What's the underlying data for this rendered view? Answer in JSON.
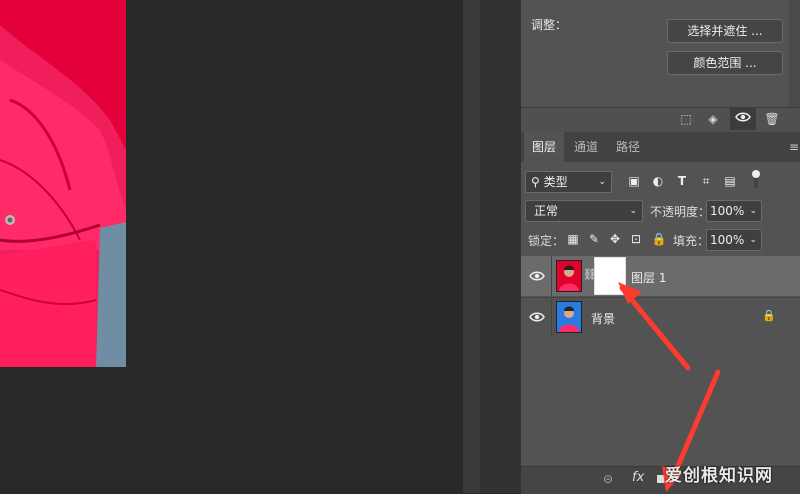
{
  "properties": {
    "section_label": "调整：",
    "select_mask_button": "选择并遮住 ...",
    "color_range_button": "颜色范围 ..."
  },
  "panel_footer_icons": [
    "selection-icon",
    "apply-mask-icon",
    "visibility-icon",
    "trash-icon"
  ],
  "layers_panel": {
    "tabs": [
      "图层",
      "通道",
      "路径"
    ],
    "active_tab": "图层",
    "filter_kind_label": "类型",
    "blend_mode": "正常",
    "opacity_label": "不透明度：",
    "opacity_value": "100%",
    "lock_label": "锁定：",
    "fill_label": "填充：",
    "fill_value": "100%",
    "layers": [
      {
        "name": "图层 1",
        "selected": true,
        "has_mask": true
      },
      {
        "name": "背景",
        "selected": false,
        "locked": true
      }
    ],
    "bottom_icons": [
      "link-icon",
      "fx-icon",
      "add-mask-icon"
    ]
  },
  "watermark": "爱创根知识网",
  "colors": {
    "canvas_bg": "#282828",
    "panel_bg": "#535353",
    "selected_layer": "#6b6b6b",
    "photo_red": "#e0003a",
    "annotation_arrow": "#ff3b30"
  }
}
